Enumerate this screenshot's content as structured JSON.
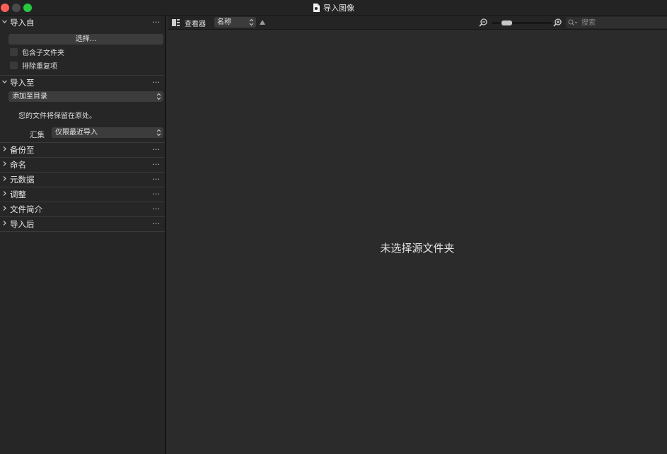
{
  "window": {
    "title": "导入图像"
  },
  "sidebar": {
    "sections": [
      {
        "key": "import_from",
        "title": "导入自",
        "expanded": true,
        "menu": "···"
      },
      {
        "key": "import_to",
        "title": "导入至",
        "expanded": true,
        "menu": "···"
      },
      {
        "key": "backup_to",
        "title": "备份至",
        "expanded": false,
        "menu": "···"
      },
      {
        "key": "naming",
        "title": "命名",
        "expanded": false,
        "menu": "···"
      },
      {
        "key": "metadata",
        "title": "元数据",
        "expanded": false,
        "menu": "···"
      },
      {
        "key": "adjustments",
        "title": "调整",
        "expanded": false,
        "menu": "···"
      },
      {
        "key": "file_profile",
        "title": "文件简介",
        "expanded": false,
        "menu": "···"
      },
      {
        "key": "after_import",
        "title": "导入后",
        "expanded": false,
        "menu": "···"
      }
    ],
    "import_from": {
      "choose_button": "选择...",
      "include_subfolders": {
        "label": "包含子文件夹",
        "checked": false
      },
      "exclude_duplicates": {
        "label": "排除重复项",
        "checked": false
      }
    },
    "import_to": {
      "destination_select": "添加至目录",
      "note": "您的文件将保留在原处。",
      "collection_label": "汇集",
      "collection_select": "仅限最近导入"
    }
  },
  "toolbar": {
    "viewer_label": "查看器",
    "sort_select": "名称",
    "sort_direction": "ascending",
    "zoom_level": 0.2,
    "search_placeholder": "搜索"
  },
  "main": {
    "empty_message": "未选择源文件夹"
  },
  "colors": {
    "close": "#fe5f57",
    "minimize": "#4a4a4a",
    "zoom": "#27c840",
    "background": "#2b2b2b",
    "sidebar": "#262626"
  }
}
